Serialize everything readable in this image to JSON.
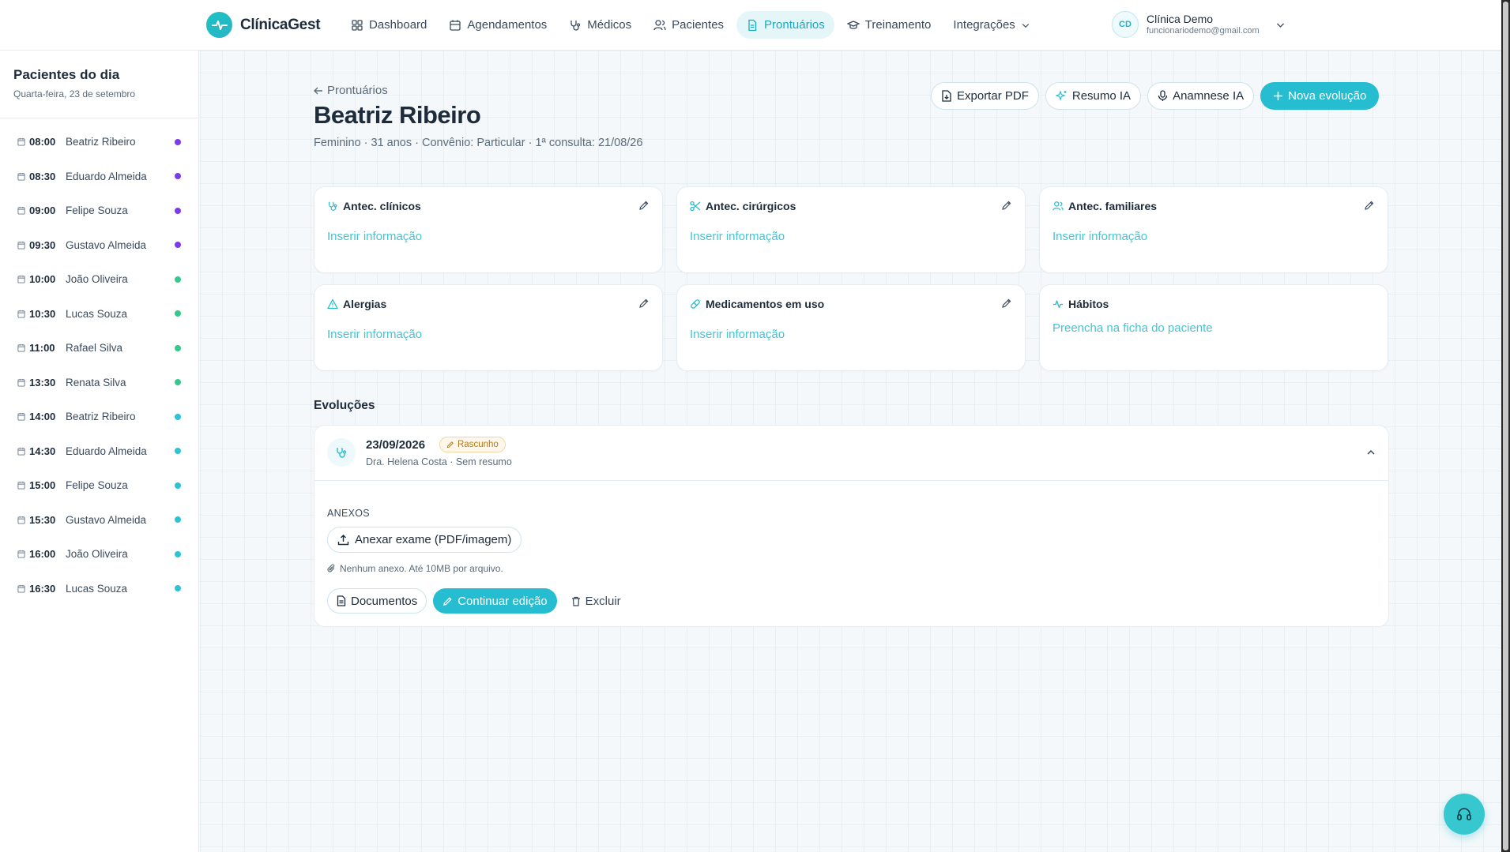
{
  "brand": {
    "name": "ClínicaGest"
  },
  "nav": [
    {
      "label": "Dashboard",
      "icon": "dashboard-icon"
    },
    {
      "label": "Agendamentos",
      "icon": "calendar-icon"
    },
    {
      "label": "Médicos",
      "icon": "stethoscope-icon"
    },
    {
      "label": "Pacientes",
      "icon": "users-icon"
    },
    {
      "label": "Prontuários",
      "icon": "document-icon",
      "active": true
    },
    {
      "label": "Treinamento",
      "icon": "graduation-cap-icon"
    },
    {
      "label": "Integrações",
      "icon": "chevron-down-icon"
    }
  ],
  "user": {
    "initials": "CD",
    "name": "Clínica Demo",
    "email": "funcionariodemo@gmail.com"
  },
  "sidebar": {
    "title": "Pacientes do dia",
    "date": "Quarta-feira, 23 de setembro",
    "appointments": [
      {
        "time": "08:00",
        "name": "Beatriz Ribeiro",
        "color": "#7c3aed"
      },
      {
        "time": "08:30",
        "name": "Eduardo Almeida",
        "color": "#7c3aed"
      },
      {
        "time": "09:00",
        "name": "Felipe Souza",
        "color": "#7c3aed"
      },
      {
        "time": "09:30",
        "name": "Gustavo Almeida",
        "color": "#7c3aed"
      },
      {
        "time": "10:00",
        "name": "João Oliveira",
        "color": "#34c98a"
      },
      {
        "time": "10:30",
        "name": "Lucas Souza",
        "color": "#34c98a"
      },
      {
        "time": "11:00",
        "name": "Rafael Silva",
        "color": "#34c98a"
      },
      {
        "time": "13:30",
        "name": "Renata Silva",
        "color": "#34c98a"
      },
      {
        "time": "14:00",
        "name": "Beatriz Ribeiro",
        "color": "#2cc3d6"
      },
      {
        "time": "14:30",
        "name": "Eduardo Almeida",
        "color": "#2cc3d6"
      },
      {
        "time": "15:00",
        "name": "Felipe Souza",
        "color": "#2cc3d6"
      },
      {
        "time": "15:30",
        "name": "Gustavo Almeida",
        "color": "#2cc3d6"
      },
      {
        "time": "16:00",
        "name": "João Oliveira",
        "color": "#2cc3d6"
      },
      {
        "time": "16:30",
        "name": "Lucas Souza",
        "color": "#2cc3d6"
      }
    ]
  },
  "header": {
    "back_label": "Prontuários",
    "patient_name": "Beatriz Ribeiro",
    "patient_meta": "Feminino · 31 anos · Convênio: Particular · 1ª consulta: 21/08/26",
    "actions": {
      "export_pdf": "Exportar PDF",
      "resumo_ia": "Resumo IA",
      "anamnese_ia": "Anamnese IA",
      "nova_evolucao": "Nova evolução"
    }
  },
  "cards": [
    {
      "title": "Antec. clínicos",
      "link": "Inserir informação",
      "icon": "stethoscope-icon",
      "editable": true
    },
    {
      "title": "Antec. cirúrgicos",
      "link": "Inserir informação",
      "icon": "scissors-icon",
      "editable": true
    },
    {
      "title": "Antec. familiares",
      "link": "Inserir informação",
      "icon": "users-icon",
      "editable": true
    },
    {
      "title": "Alergias",
      "link": "Inserir informação",
      "icon": "warning-icon",
      "editable": true
    },
    {
      "title": "Medicamentos em uso",
      "link": "Inserir informação",
      "icon": "pill-icon",
      "editable": true
    },
    {
      "title": "Hábitos",
      "link": "Preencha na ficha do paciente",
      "icon": "activity-icon",
      "editable": false
    }
  ],
  "evolutions": {
    "title": "Evoluções",
    "item": {
      "date": "23/09/2026",
      "badge": "Rascunho",
      "subtitle": "Dra. Helena Costa · Sem resumo",
      "anexos_label": "ANEXOS",
      "attach_button": "Anexar exame (PDF/imagem)",
      "attach_note": "Nenhum anexo. Até 10MB por arquivo.",
      "documentos_button": "Documentos",
      "continuar_button": "Continuar edição",
      "excluir_button": "Excluir"
    }
  },
  "colors": {
    "accent": "#26bdd0",
    "accent_light": "#46c4d4",
    "active_nav_bg": "#e5f6f8"
  }
}
